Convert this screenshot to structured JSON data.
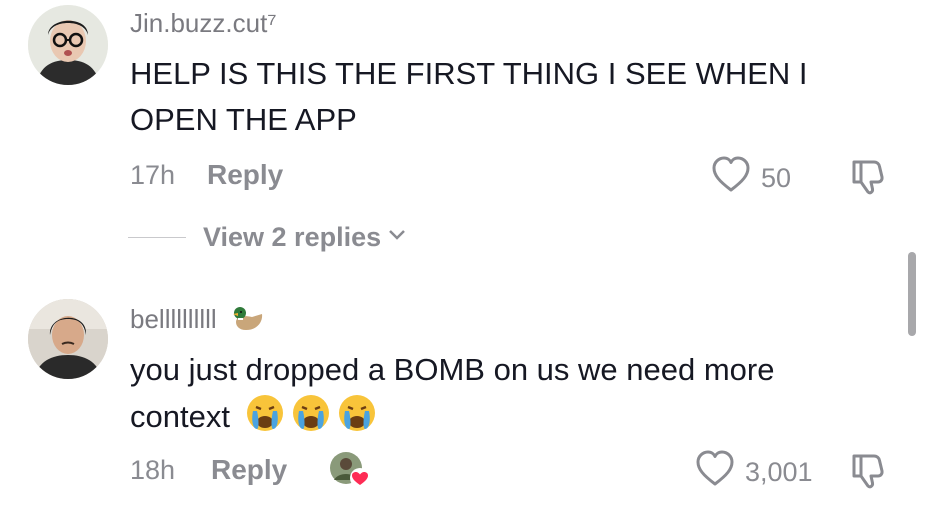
{
  "comments": [
    {
      "username": "Jin.buzz.cut⁷",
      "text_line1": "HELP IS THIS THE FIRST THING I SEE WHEN I",
      "text_line2": "OPEN THE APP",
      "time": "17h",
      "reply_label": "Reply",
      "likes": "50",
      "view_replies": "View 2 replies"
    },
    {
      "username": "bellllllllll",
      "username_emoji": "duck-emoji",
      "text_line1": "you just dropped a BOMB on us we need more",
      "text_line2": "context",
      "text_emojis": [
        "crying-face-emoji",
        "crying-face-emoji",
        "crying-face-emoji"
      ],
      "time": "18h",
      "reply_label": "Reply",
      "likes": "3,001",
      "liked_by_creator": true
    }
  ],
  "colors": {
    "text": "#161823",
    "secondary": "#8a8b91",
    "heart_badge": "#fe2c55"
  }
}
